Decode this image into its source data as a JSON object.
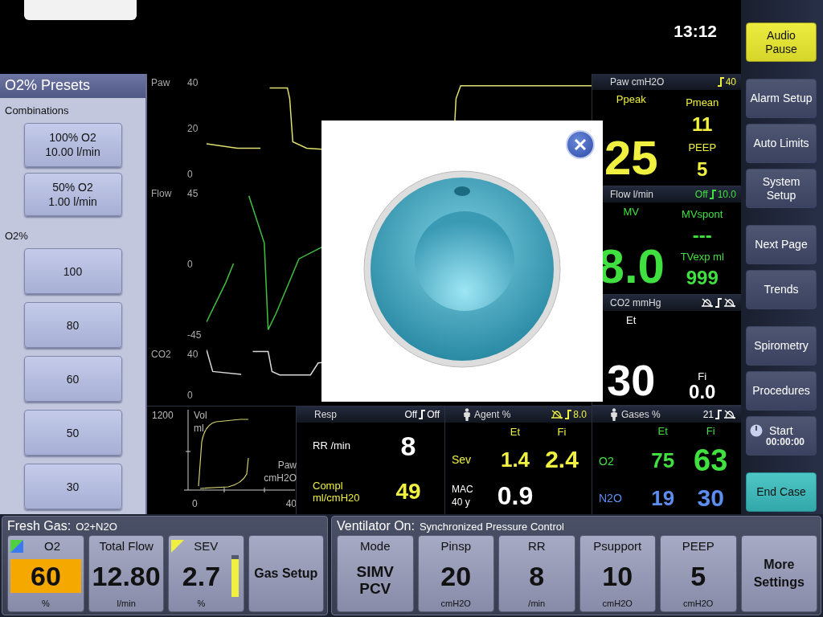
{
  "clock": "13:12",
  "presets": {
    "title": "O2% Presets",
    "combinations_label": "Combinations",
    "combinations": [
      {
        "line1": "100% O2",
        "line2": "10.00 l/min"
      },
      {
        "line1": "50% O2",
        "line2": "1.00 l/min"
      }
    ],
    "o2_label": "O2%",
    "o2_values": [
      "100",
      "80",
      "60",
      "50",
      "30"
    ]
  },
  "waveforms": [
    {
      "kind": "pressure",
      "label": "Paw",
      "ticks": [
        "40",
        "20",
        "0"
      ],
      "color": "#e0e070"
    },
    {
      "kind": "flow",
      "label": "Flow",
      "ticks": [
        "45",
        "0",
        "-45"
      ],
      "color": "#40c040"
    },
    {
      "kind": "co2",
      "label": "CO2",
      "ticks": [
        "40",
        "0"
      ],
      "color": "#d8d8d8"
    }
  ],
  "loop": {
    "y_max": "1200",
    "y_label": [
      "Vol",
      "ml"
    ],
    "x_label": [
      "Paw",
      "cmH2O"
    ],
    "x_min": "0",
    "x_max": "40"
  },
  "numerics": [
    {
      "kind": "pressure",
      "title": "Paw cmH2O",
      "color": "#f0f040",
      "high": {
        "kind": "text",
        "text": "40"
      },
      "main": {
        "label": "Ppeak",
        "value": "25"
      },
      "side": [
        {
          "label": "Pmean",
          "value": "11"
        },
        {
          "label": "PEEP",
          "value": "5"
        }
      ]
    },
    {
      "kind": "pressure",
      "title": "Flow l/min",
      "color": "#40e040",
      "low": {
        "kind": "text",
        "text": "Off"
      },
      "high": {
        "kind": "text",
        "text": "10.0"
      },
      "main": {
        "label": "MV",
        "value": "8.0"
      },
      "side": [
        {
          "label": "MVspont",
          "value": "---"
        },
        {
          "label": "TVexp ml",
          "value": "999"
        }
      ]
    },
    {
      "kind": "gas",
      "title": "CO2 mmHg",
      "color": "#ffffff",
      "low": {
        "kind": "muted"
      },
      "high": {
        "kind": "muted"
      },
      "main": {
        "label": "Et",
        "value": "30"
      },
      "side": [
        {
          "label": "Fi",
          "value": "0.0"
        }
      ]
    }
  ],
  "resp": {
    "title": "Resp",
    "color": "#ffffff",
    "low": {
      "kind": "text",
      "text": "Off"
    },
    "high": {
      "kind": "text",
      "text": "Off"
    },
    "rows": [
      {
        "label": [
          "RR /min"
        ],
        "value": "8",
        "color": "#ffffff"
      },
      {
        "label": [
          "Compl",
          "ml/cmH20"
        ],
        "value": "49",
        "color": "#f0f040"
      }
    ]
  },
  "agent": {
    "title": "Agent %",
    "patient": true,
    "color": "#f0f040",
    "low": {
      "kind": "muted"
    },
    "high": {
      "kind": "text",
      "text": "8.0"
    },
    "columns": [
      "Et",
      "Fi"
    ],
    "rows": [
      {
        "label": "Sev",
        "et": "1.4",
        "fi": "2.4",
        "color": "#f0f040"
      }
    ],
    "mac": {
      "label": [
        "MAC",
        "40 y"
      ],
      "value": "0.9"
    }
  },
  "gases": {
    "title": "Gases %",
    "patient": true,
    "color": "#ffffff",
    "low": {
      "kind": "text",
      "text": "21"
    },
    "high": {
      "kind": "muted"
    },
    "columns": [
      "Et",
      "Fi"
    ],
    "rows": [
      {
        "label": "O2",
        "et": "75",
        "fi": "63",
        "color": "#40e040"
      },
      {
        "label": "N2O",
        "et": "19",
        "fi": "30",
        "color": "#5c8ef0"
      }
    ]
  },
  "side_buttons": [
    [
      {
        "kind": "alert",
        "label": [
          "Audio",
          "Pause"
        ]
      }
    ],
    [
      {
        "kind": "normal",
        "label": [
          "Alarm Setup"
        ]
      },
      {
        "kind": "normal",
        "label": [
          "Auto Limits"
        ]
      },
      {
        "kind": "normal",
        "label": [
          "System",
          "Setup"
        ]
      }
    ],
    [
      {
        "kind": "normal",
        "label": [
          "Next Page"
        ]
      },
      {
        "kind": "normal",
        "label": [
          "Trends"
        ]
      }
    ],
    [
      {
        "kind": "normal",
        "label": [
          "Spirometry"
        ]
      },
      {
        "kind": "normal",
        "label": [
          "Procedures"
        ]
      },
      {
        "kind": "timer",
        "label": [
          "Start",
          "00:00:00"
        ]
      }
    ],
    [
      {
        "kind": "teal",
        "label": [
          "End Case"
        ]
      }
    ]
  ],
  "fresh_gas": {
    "title": "Fresh Gas:",
    "subtitle": "O2+N2O",
    "tiles": [
      {
        "kind": "o2",
        "label": "O2",
        "value": "60",
        "unit": "%"
      },
      {
        "kind": "plain",
        "label": "Total Flow",
        "value": "12.80",
        "unit": "l/min"
      },
      {
        "kind": "agent",
        "label": "SEV",
        "value": "2.7",
        "unit": "%",
        "level": 0.9
      },
      {
        "kind": "action",
        "label": "Gas Setup"
      }
    ]
  },
  "ventilator": {
    "title": "Ventilator On:",
    "subtitle": "Synchronized Pressure Control",
    "tiles": [
      {
        "kind": "mode",
        "label": "Mode",
        "lines": [
          "SIMV",
          "PCV"
        ]
      },
      {
        "kind": "plain",
        "label": "Pinsp",
        "value": "20",
        "unit": "cmH2O"
      },
      {
        "kind": "plain",
        "label": "RR",
        "value": "8",
        "unit": "/min"
      },
      {
        "kind": "plain",
        "label": "Psupport",
        "value": "10",
        "unit": "cmH2O"
      },
      {
        "kind": "plain",
        "label": "PEEP",
        "value": "5",
        "unit": "cmH2O"
      },
      {
        "kind": "action",
        "label": "More Settings"
      }
    ]
  }
}
